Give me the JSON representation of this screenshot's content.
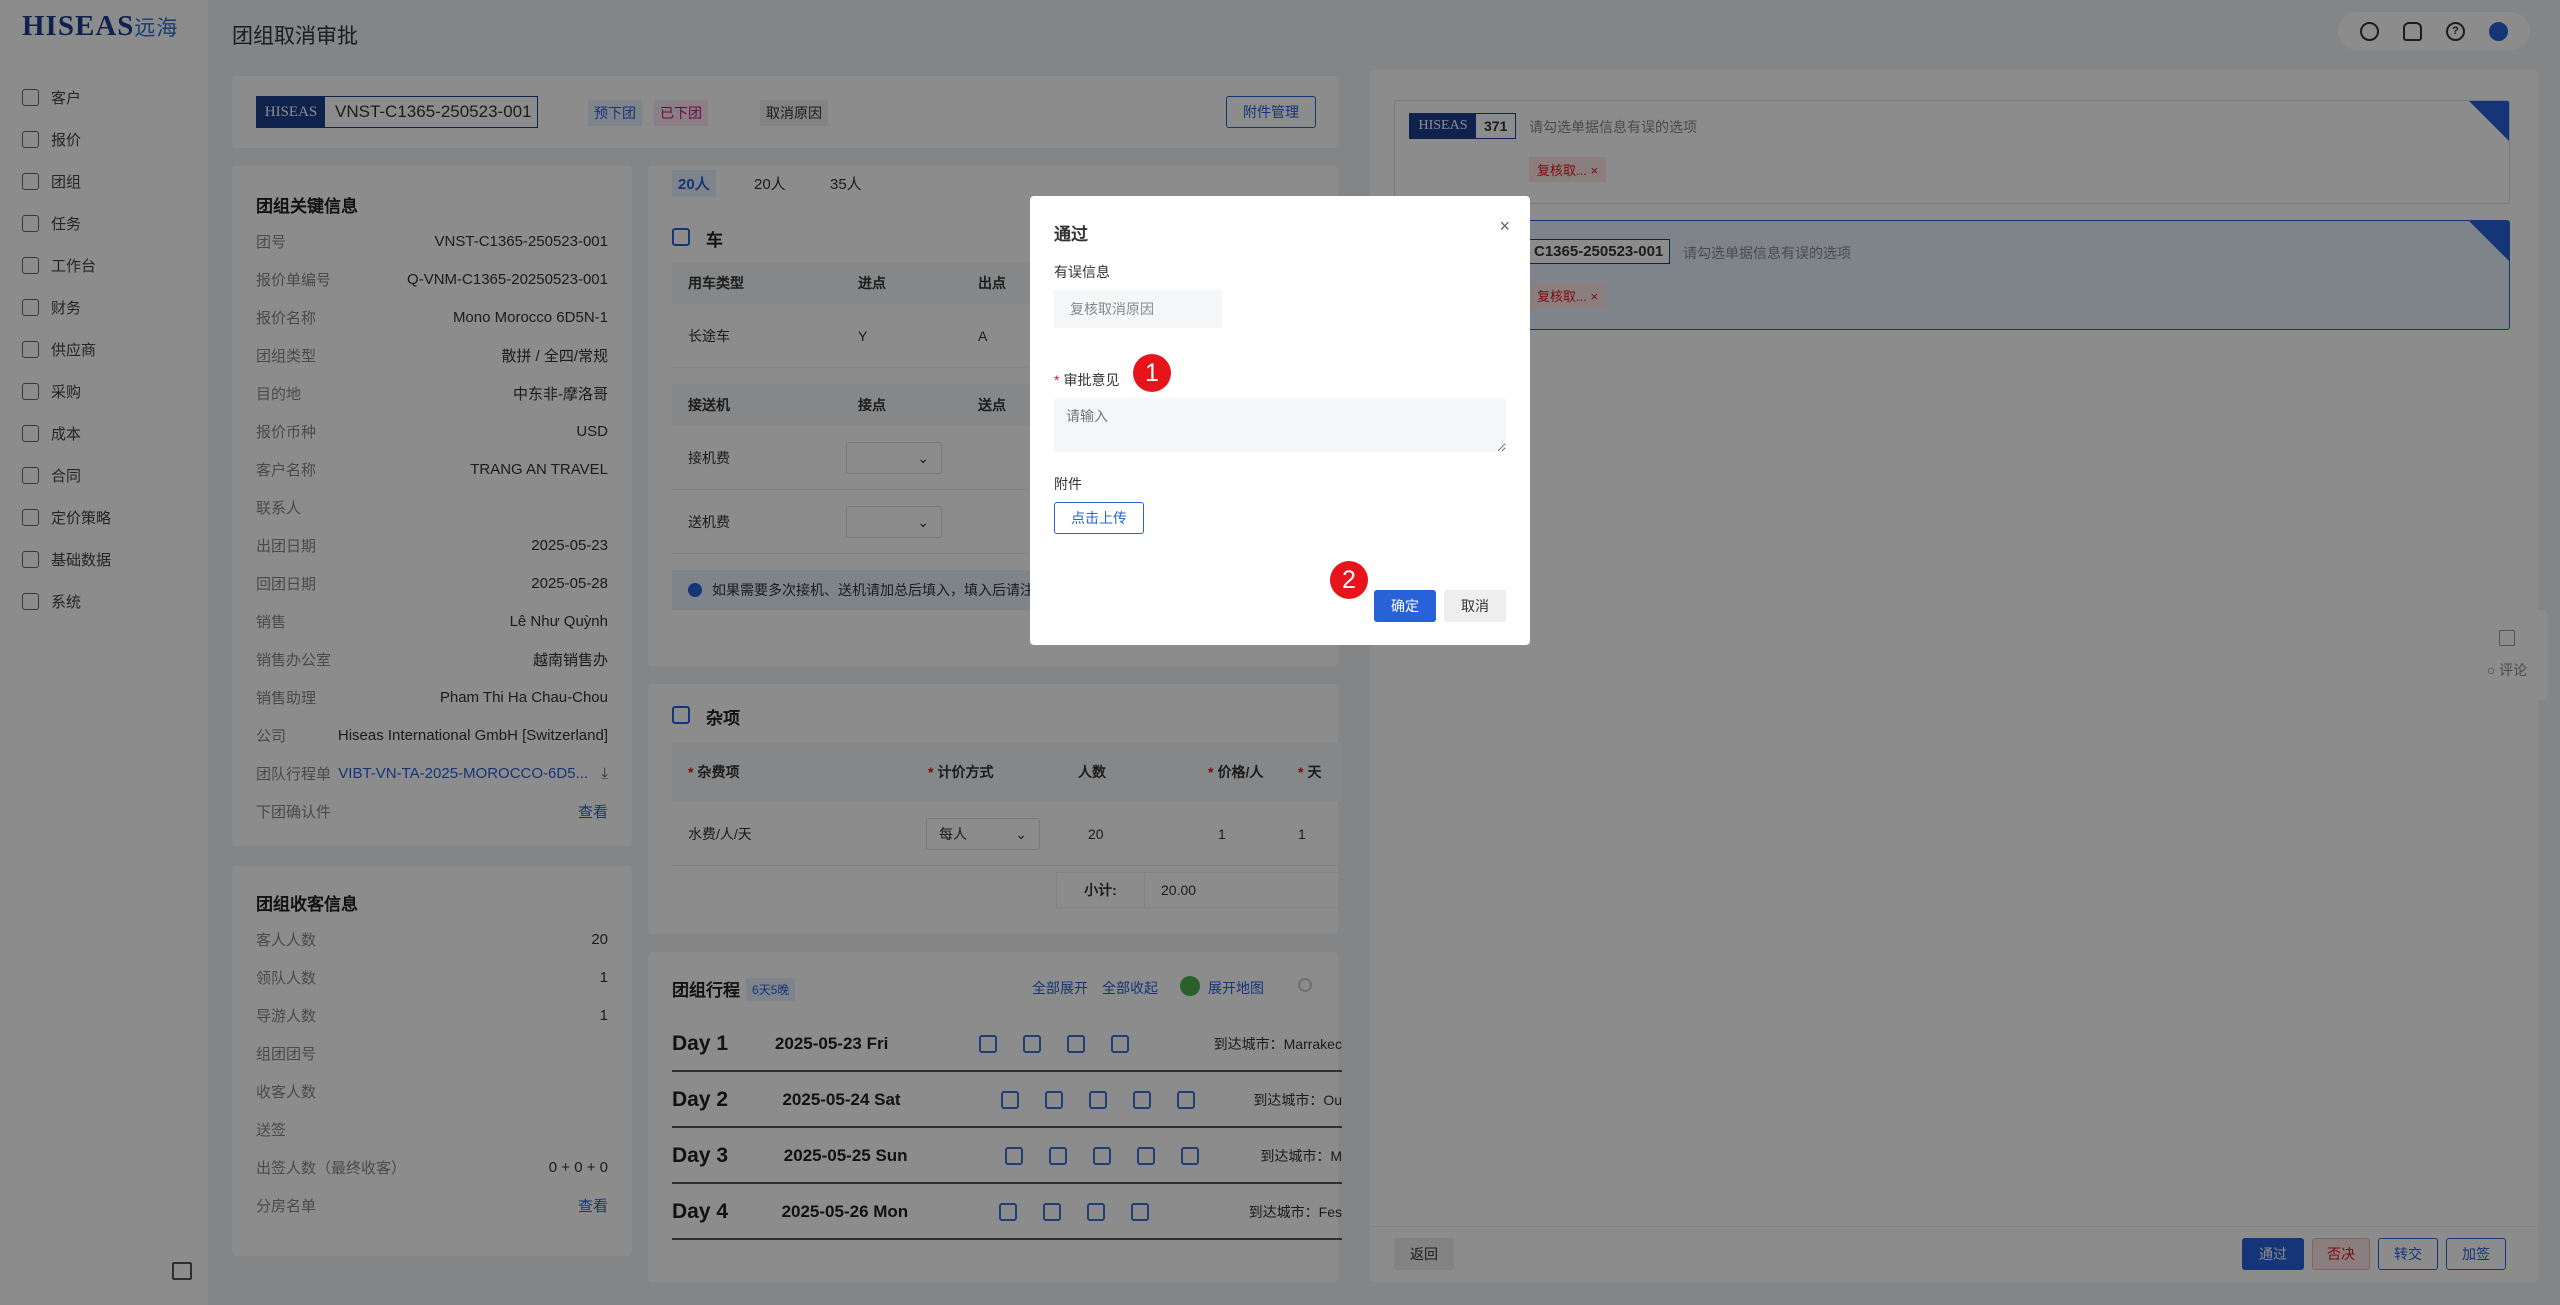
{
  "sidebar": {
    "logo_text": "HISEAS",
    "logo_cn": "远海",
    "items": [
      {
        "label": "客户",
        "icon": "customer-icon"
      },
      {
        "label": "报价",
        "icon": "quote-icon"
      },
      {
        "label": "团组",
        "icon": "group-icon"
      },
      {
        "label": "任务",
        "icon": "task-icon"
      },
      {
        "label": "工作台",
        "icon": "workbench-icon"
      },
      {
        "label": "财务",
        "icon": "finance-icon"
      },
      {
        "label": "供应商",
        "icon": "supplier-icon"
      },
      {
        "label": "采购",
        "icon": "purchase-icon"
      },
      {
        "label": "成本",
        "icon": "cost-icon"
      },
      {
        "label": "合同",
        "icon": "contract-icon"
      },
      {
        "label": "定价策略",
        "icon": "pricing-icon"
      },
      {
        "label": "基础数据",
        "icon": "basedata-icon"
      },
      {
        "label": "系统",
        "icon": "system-icon"
      }
    ]
  },
  "header": {
    "title": "团组取消审批"
  },
  "groupbar": {
    "brand": "HISEAS",
    "code": "VNST-C1365-250523-001",
    "tag_pre": "预下团",
    "tag_done": "已下团",
    "tag_reason": "取消原因",
    "attach_btn": "附件管理"
  },
  "key_info": {
    "title": "团组关键信息",
    "rows": [
      {
        "k": "团号",
        "v": "VNST-C1365-250523-001"
      },
      {
        "k": "报价单编号",
        "v": "Q-VNM-C1365-20250523-001"
      },
      {
        "k": "报价名称",
        "v": "Mono Morocco 6D5N-1"
      },
      {
        "k": "团组类型",
        "v": "散拼 / 全四/常规"
      },
      {
        "k": "目的地",
        "v": "中东非-摩洛哥"
      },
      {
        "k": "报价币种",
        "v": "USD"
      },
      {
        "k": "客户名称",
        "v": "TRANG AN TRAVEL"
      },
      {
        "k": "联系人",
        "v": ""
      },
      {
        "k": "出团日期",
        "v": "2025-05-23"
      },
      {
        "k": "回团日期",
        "v": "2025-05-28"
      },
      {
        "k": "销售",
        "v": "Lê Như Quỳnh"
      },
      {
        "k": "销售办公室",
        "v": "越南销售办"
      },
      {
        "k": "销售助理",
        "v": "Pham Thi Ha Chau-Chou"
      },
      {
        "k": "公司",
        "v": "Hiseas International GmbH [Switzerland]"
      },
      {
        "k": "团队行程单",
        "v": "VIBT-VN-TA-2025-MOROCCO-6D5..."
      },
      {
        "k": "下团确认件",
        "v": "查看"
      }
    ]
  },
  "guest_info": {
    "title": "团组收客信息",
    "rows": [
      {
        "k": "客人人数",
        "v": "20"
      },
      {
        "k": "领队人数",
        "v": "1"
      },
      {
        "k": "导游人数",
        "v": "1"
      },
      {
        "k": "组团团号",
        "v": ""
      },
      {
        "k": "收客人数",
        "v": ""
      },
      {
        "k": "送签",
        "v": ""
      },
      {
        "k": "出签人数（最终收客）",
        "v": "0 + 0 + 0"
      },
      {
        "k": "分房名单",
        "v": "查看"
      }
    ]
  },
  "pax_tabs": [
    "20人",
    "20人",
    "35人"
  ],
  "car": {
    "title": "车",
    "headers": [
      "用车类型",
      "进点",
      "出点"
    ],
    "row": [
      "长途车",
      "Y",
      "A"
    ],
    "transfer_headers": [
      "接送机",
      "接点",
      "送点"
    ],
    "transfer_rows": [
      "接机费",
      "送机费"
    ],
    "notice": "如果需要多次接机、送机请加总后填入，填入后请注"
  },
  "misc": {
    "title": "杂项",
    "headers": [
      "杂费项",
      "计价方式",
      "人数",
      "价格/人",
      "天"
    ],
    "row": {
      "item": "水费/人/天",
      "method": "每人",
      "count": "20",
      "price": "1",
      "days": "1"
    },
    "subtotal_label": "小计:",
    "subtotal_value": "20.00"
  },
  "itinerary": {
    "title": "团组行程",
    "badge": "6天5晚",
    "expand_all": "全部展开",
    "collapse_all": "全部收起",
    "map": "展开地图",
    "days": [
      {
        "day": "Day 1",
        "date": "2025-05-23 Fri",
        "city": "到达城市：Marrakec"
      },
      {
        "day": "Day 2",
        "date": "2025-05-24 Sat",
        "city": "到达城市：Ou"
      },
      {
        "day": "Day 3",
        "date": "2025-05-25 Sun",
        "city": "到达城市：M"
      },
      {
        "day": "Day 4",
        "date": "2025-05-26 Mon",
        "city": "到达城市：Fes"
      }
    ]
  },
  "review": {
    "items": [
      {
        "code": "371",
        "hint": "请勾选单据信息有误的选项",
        "chip": "复核取..."
      },
      {
        "code": "C1365-250523-001",
        "hint": "请勾选单据信息有误的选项",
        "chip": "复核取..."
      }
    ],
    "back": "返回",
    "approve": "通过",
    "reject": "否决",
    "transfer": "转交",
    "add_sign": "加签",
    "side_comment": "评论"
  },
  "modal": {
    "title": "通过",
    "error_label": "有误信息",
    "error_value": "复核取消原因",
    "opinion_label": "审批意见",
    "opinion_placeholder": "请输入",
    "attach_label": "附件",
    "upload": "点击上传",
    "confirm": "确定",
    "cancel": "取消",
    "badge1": "1",
    "badge2": "2"
  }
}
